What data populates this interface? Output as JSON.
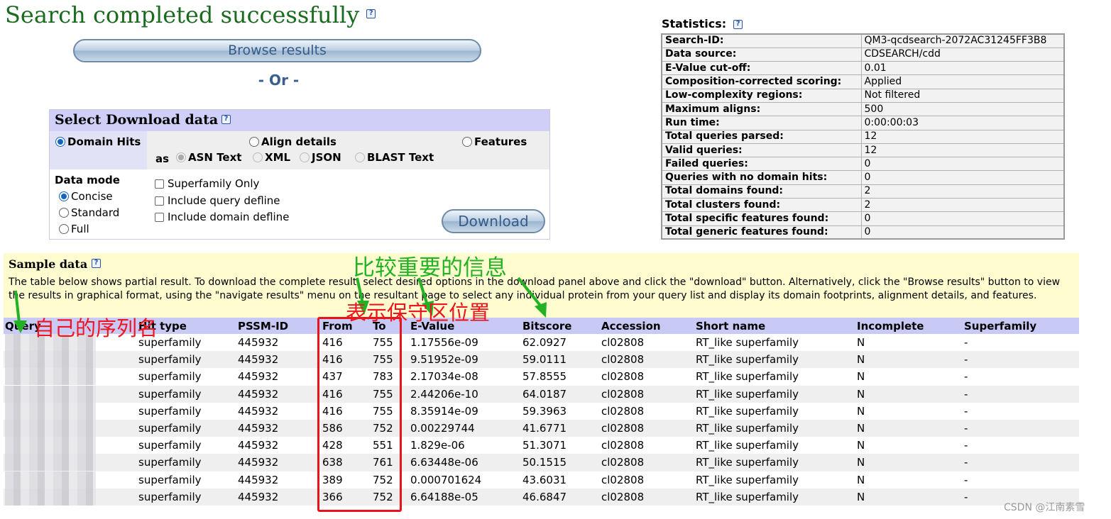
{
  "header": {
    "title": "Search completed successfully",
    "browse_label": "Browse results",
    "or_label": "- Or -"
  },
  "download_panel": {
    "title": "Select Download data",
    "type_options": [
      "Domain Hits",
      "Align details",
      "Features"
    ],
    "selected_type": "Domain Hits",
    "as_label": "as",
    "format_options": [
      "ASN Text",
      "XML",
      "JSON",
      "BLAST Text"
    ],
    "data_mode_label": "Data mode",
    "data_mode_options": [
      "Concise",
      "Standard",
      "Full"
    ],
    "selected_data_mode": "Concise",
    "checkboxes": [
      "Superfamily Only",
      "Include query defline",
      "Include domain defline"
    ],
    "download_label": "Download"
  },
  "statistics": {
    "title": "Statistics:",
    "rows": [
      {
        "key": "Search-ID:",
        "value": "QM3-qcdsearch-2072AC31245FF3B8"
      },
      {
        "key": "Data source:",
        "value": "CDSEARCH/cdd"
      },
      {
        "key": "E-Value cut-off:",
        "value": "0.01"
      },
      {
        "key": "Composition-corrected scoring:",
        "value": "Applied"
      },
      {
        "key": "Low-complexity regions:",
        "value": "Not filtered"
      },
      {
        "key": "Maximum aligns:",
        "value": "500"
      },
      {
        "key": "Run time:",
        "value": "0:00:00:03"
      },
      {
        "key": "Total queries parsed:",
        "value": "12"
      },
      {
        "key": "Valid queries:",
        "value": "12"
      },
      {
        "key": "Failed queries:",
        "value": "0"
      },
      {
        "key": "Queries with no domain hits:",
        "value": "0"
      },
      {
        "key": "Total domains found:",
        "value": "2"
      },
      {
        "key": "Total clusters found:",
        "value": "2"
      },
      {
        "key": "Total specific features found:",
        "value": "0"
      },
      {
        "key": "Total generic features found:",
        "value": "0"
      }
    ]
  },
  "sample": {
    "title": "Sample data",
    "description": "The table below shows partial result. To download the complete result, select desired options in the download panel above and click the \"download\" button. Alternatively, click the \"Browse results\" button to view the results in graphical format, using the \"navigate results\" menu on the resultant page to select any individual protein from your query list and display its domain footprints, alignment details, and features."
  },
  "results": {
    "columns": [
      "Query",
      "Hit type",
      "PSSM-ID",
      "From",
      "To",
      "E-Value",
      "Bitscore",
      "Accession",
      "Short name",
      "Incomplete",
      "Superfamily"
    ],
    "rows": [
      [
        "",
        "superfamily",
        "445932",
        "416",
        "755",
        "1.17556e-09",
        "62.0927",
        "cl02808",
        "RT_like superfamily",
        "N",
        "-"
      ],
      [
        "",
        "superfamily",
        "445932",
        "416",
        "755",
        "9.51952e-09",
        "59.0111",
        "cl02808",
        "RT_like superfamily",
        "N",
        "-"
      ],
      [
        "",
        "superfamily",
        "445932",
        "437",
        "783",
        "2.17034e-08",
        "57.8555",
        "cl02808",
        "RT_like superfamily",
        "N",
        "-"
      ],
      [
        "",
        "superfamily",
        "445932",
        "416",
        "755",
        "2.44206e-10",
        "64.0187",
        "cl02808",
        "RT_like superfamily",
        "N",
        "-"
      ],
      [
        "",
        "superfamily",
        "445932",
        "416",
        "755",
        "8.35914e-09",
        "59.3963",
        "cl02808",
        "RT_like superfamily",
        "N",
        "-"
      ],
      [
        "",
        "superfamily",
        "445932",
        "586",
        "752",
        "0.00229744",
        "41.6771",
        "cl02808",
        "RT_like superfamily",
        "N",
        "-"
      ],
      [
        "",
        "superfamily",
        "445932",
        "428",
        "551",
        "1.829e-06",
        "51.3071",
        "cl02808",
        "RT_like superfamily",
        "N",
        "-"
      ],
      [
        "",
        "superfamily",
        "445932",
        "638",
        "761",
        "6.63448e-06",
        "50.1515",
        "cl02808",
        "RT_like superfamily",
        "N",
        "-"
      ],
      [
        "",
        "superfamily",
        "445932",
        "389",
        "752",
        "0.000701624",
        "43.6031",
        "cl02808",
        "RT_like superfamily",
        "N",
        "-"
      ],
      [
        "",
        "superfamily",
        "445932",
        "366",
        "752",
        "6.64188e-05",
        "46.6847",
        "cl02808",
        "RT_like superfamily",
        "N",
        "-"
      ]
    ]
  },
  "annotations": {
    "own_sequence_name": "自己的序列名",
    "important_info": "比较重要的信息",
    "conserved_region_position": "表示保守区位置"
  },
  "watermark": "CSDN @江南素雪",
  "colors": {
    "title_green": "#1b6b1e",
    "panel_header": "#cfcff7",
    "table_header": "#c9c9f5",
    "sample_bg": "#fffdd0",
    "annotation_red": "#f0141e",
    "annotation_green": "#23b223"
  }
}
